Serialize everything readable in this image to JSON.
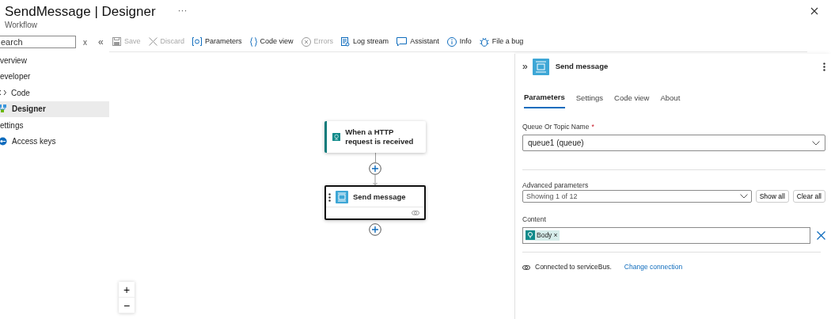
{
  "header": {
    "title": "SendMessage | Designer",
    "more": "···",
    "subtitle": "Workflow"
  },
  "sidebar": {
    "search": {
      "placeholder": "earch"
    },
    "clear": "x",
    "collapse": "«",
    "items": [
      {
        "label": "verview",
        "kind": "plain",
        "selected": false
      },
      {
        "label": "eveloper",
        "kind": "plain",
        "selected": false
      },
      {
        "label": "Code",
        "kind": "code",
        "selected": false
      },
      {
        "label": "Designer",
        "kind": "designer",
        "selected": true
      },
      {
        "label": "ettings",
        "kind": "plain",
        "selected": false
      },
      {
        "label": "Access keys",
        "kind": "keys",
        "selected": false
      }
    ]
  },
  "toolbar": [
    {
      "label": "Save",
      "kind": "save",
      "disabled": true
    },
    {
      "label": "Discard",
      "kind": "discard",
      "disabled": true
    },
    {
      "label": "Parameters",
      "kind": "parameters",
      "disabled": false
    },
    {
      "label": "Code view",
      "kind": "code",
      "disabled": false
    },
    {
      "label": "Errors",
      "kind": "errors",
      "disabled": true
    },
    {
      "label": "Log stream",
      "kind": "log",
      "disabled": false
    },
    {
      "label": "Assistant",
      "kind": "assistant",
      "disabled": false
    },
    {
      "label": "Info",
      "kind": "info",
      "disabled": false
    },
    {
      "label": "File a bug",
      "kind": "bug",
      "disabled": false
    }
  ],
  "canvas": {
    "nodes": [
      {
        "title": "When a HTTP request is received",
        "kind": "trigger",
        "selected": false
      },
      {
        "title": "Send message",
        "kind": "action",
        "selected": true
      }
    ],
    "zoom": [
      "+",
      "−"
    ]
  },
  "panel": {
    "expand": "»",
    "title": "Send message",
    "tabs": [
      {
        "label": "Parameters",
        "selected": true
      },
      {
        "label": "Settings",
        "selected": false
      },
      {
        "label": "Code view",
        "selected": false
      },
      {
        "label": "About",
        "selected": false
      }
    ],
    "queue": {
      "label": "Queue Or Topic Name",
      "required_mark": "*",
      "value": "queue1 (queue)"
    },
    "advanced": {
      "label": "Advanced parameters",
      "value": "Showing 1 of 12",
      "buttons": [
        "Show all",
        "Clear all"
      ]
    },
    "content": {
      "label": "Content",
      "token": "Body",
      "token_remove": "×"
    },
    "connection": {
      "text": "Connected to serviceBus.",
      "link": "Change connection"
    }
  }
}
